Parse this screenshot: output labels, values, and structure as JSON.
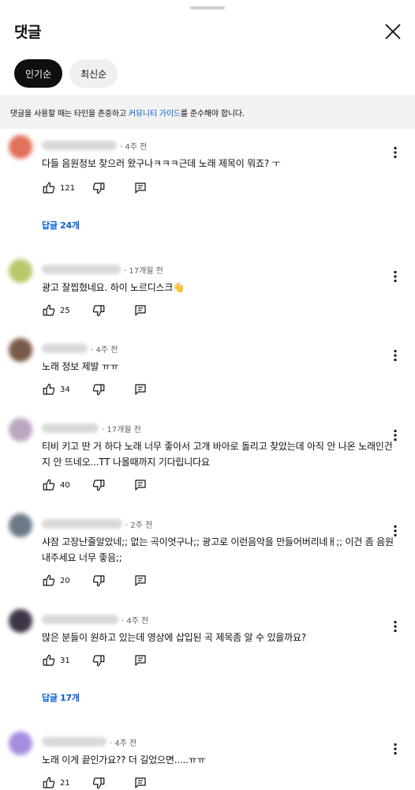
{
  "header": {
    "title": "댓글"
  },
  "chips": [
    {
      "label": "인기순",
      "active": true
    },
    {
      "label": "최신순",
      "active": false
    }
  ],
  "notice": {
    "before": "댓글을 사용할 때는 타인을 존중하고 ",
    "link": "커뮤니티 가이드",
    "after": "를 준수해야 합니다."
  },
  "comments": [
    {
      "avatar_color": "#e2705a",
      "time": "· 4주 전",
      "text": "다들 음원정보 찾으러 왔구나ㅋㅋㅋ근데 노래 제목이 뭐죠? ㅜ",
      "likes": "121",
      "replies": "답글 24개"
    },
    {
      "avatar_color": "#b8c86a",
      "time": "· 17개월 전",
      "text": "광고 잘찝혔네요. 하이 노르디스크👋",
      "likes": "25",
      "replies": ""
    },
    {
      "avatar_color": "#7a5a48",
      "time": "· 4주 전",
      "text": "노래 정보 제발 ㅠㅠ",
      "likes": "34",
      "replies": ""
    },
    {
      "avatar_color": "#bba6c0",
      "time": "· 17개월 전",
      "text": "티비 키고 딴 거 하다 노래 너무 좋아서 고개 바아로 돌리고 찾았는데 아직 안 나온 노래인건지 안 뜨네오...TT 나올때까지 기다립니다요",
      "likes": "40",
      "replies": ""
    },
    {
      "avatar_color": "#6c7a88",
      "time": "· 2주 전",
      "text": "샤잠 고장난줄알았네;; 없는 곡이엇구나;; 광고로 이런음악을 만들어버리네ㅐ;; 이건 좀 음원내주세요 너무 좋음;;",
      "likes": "20",
      "replies": ""
    },
    {
      "avatar_color": "#3e3548",
      "time": "· 4주 전",
      "text": "많은 분들이 원하고 있는데 영상에 삽입된 곡 제목좀 알 수 있을까요?",
      "likes": "31",
      "replies": "답글 17개"
    },
    {
      "avatar_color": "#a58ee0",
      "time": "· 4주 전",
      "text": "노래 이게 끝인가요??  더 길었으면.....ㅠㅠ",
      "likes": "21",
      "replies": ""
    }
  ]
}
